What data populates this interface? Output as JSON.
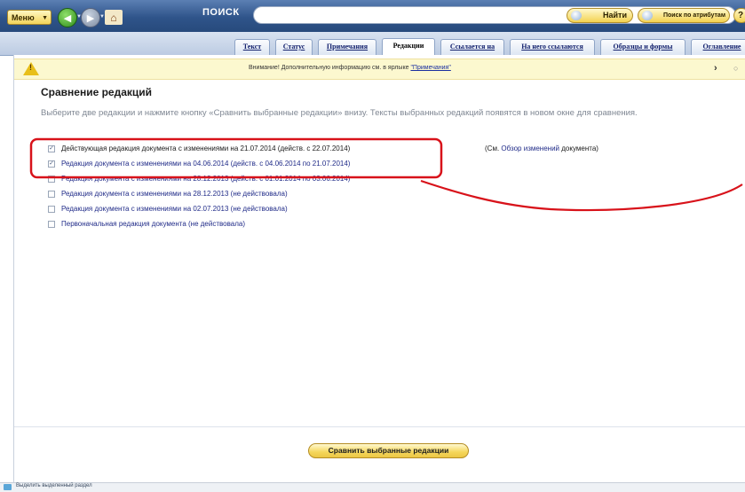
{
  "toolbar": {
    "menu_label": "Меню",
    "search_label": "ПОИСК",
    "find_label": "Найти",
    "attr_search_label": "Поиск по атрибутам",
    "help_label": "?"
  },
  "tabs": [
    {
      "label": "Текст"
    },
    {
      "label": "Статус"
    },
    {
      "label": "Примечания"
    },
    {
      "label": "Редакции",
      "active": true
    },
    {
      "label": "Ссылается на"
    },
    {
      "label": "На него ссылаются"
    },
    {
      "label": "Образцы и формы"
    },
    {
      "label": "Оглавление"
    }
  ],
  "notice": {
    "text": "Внимание! Дополнительную информацию см. в ярлыке ",
    "link": "\"Примечания\""
  },
  "page": {
    "title": "Сравнение редакций",
    "hint": "Выберите две редакции и нажмите кнопку «Сравнить выбранные редакции» внизу. Тексты выбранных редакций появятся в новом окне для сравнения."
  },
  "editions": [
    {
      "label": "Действующая редакция документа с изменениями на 21.07.2014 (действ. с 22.07.2014)",
      "checked": true,
      "current": true
    },
    {
      "label": "Редакция документа с изменениями на 04.06.2014 (действ. с 04.06.2014 по 21.07.2014)",
      "checked": true
    },
    {
      "label": "Редакция документа с изменениями на 28.12.2013 (действ. с 01.01.2014 по 03.06.2014)",
      "checked": false
    },
    {
      "label": "Редакция документа с изменениями на 28.12.2013 (не действовала)",
      "checked": false
    },
    {
      "label": "Редакция документа с изменениями на 02.07.2013 (не действовала)",
      "checked": false
    },
    {
      "label": "Первоначальная редакция документа (не действовала)",
      "checked": false
    }
  ],
  "review_note": {
    "prefix": "(См. ",
    "link": "Обзор изменений",
    "suffix": " документа)"
  },
  "compare_button": "Сравнить выбранные редакции",
  "statusbar": {
    "text": "Выделить выделенный раздел"
  },
  "colors": {
    "highlight": "#d8121a",
    "accent": "#2f548a",
    "button": "#f5d65b"
  }
}
